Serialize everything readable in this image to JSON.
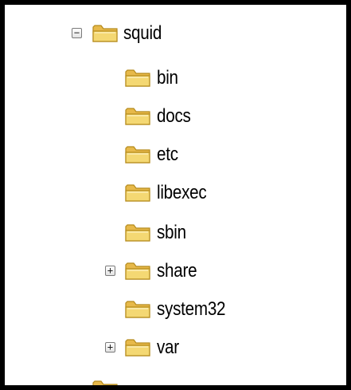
{
  "tree": {
    "root": {
      "label": "squid",
      "toggle": "−",
      "expanded": true
    },
    "children": [
      {
        "label": "bin"
      },
      {
        "label": "docs"
      },
      {
        "label": "etc"
      },
      {
        "label": "libexec"
      },
      {
        "label": "sbin"
      },
      {
        "label": "share",
        "toggle": "+",
        "expanded": false
      },
      {
        "label": "system32"
      },
      {
        "label": "var",
        "toggle": "+",
        "expanded": false
      }
    ]
  },
  "colors": {
    "folder_body": "#f2d46a",
    "folder_tab": "#f7e08e",
    "folder_outline": "#b58a1c",
    "frame_border": "#000000"
  },
  "icons": {
    "folder": "folder-icon",
    "expand": "expand-toggle-icon",
    "collapse": "collapse-toggle-icon"
  }
}
